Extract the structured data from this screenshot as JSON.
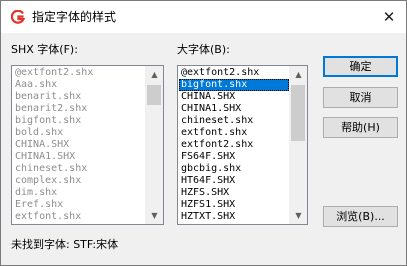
{
  "window": {
    "title": "指定字体的样式",
    "close_glyph": "✕",
    "accent_color": "#0078d7"
  },
  "shx_list": {
    "label": "SHX 字体(F):",
    "items": [
      "@extfont2.shx",
      "Aaa.shx",
      "benarit.shx",
      "benarit2.shx",
      "bigfont.shx",
      "bold.shx",
      "CHINA.SHX",
      "CHINA1.SHX",
      "chineset.shx",
      "complex.shx",
      "dim.shx",
      "Eref.shx",
      "extfont.shx"
    ]
  },
  "big_list": {
    "label": "大字体(B):",
    "selected_index": 1,
    "items": [
      "@extfont2.shx",
      "bigfont.shx",
      "CHINA.SHX",
      "CHINA1.SHX",
      "chineset.shx",
      "extfont.shx",
      "extfont2.shx",
      "FS64F.SHX",
      "gbcbig.shx",
      "HT64F.SHX",
      "HZFS.SHX",
      "HZFS1.SHX",
      "HZTXT.SHX"
    ]
  },
  "buttons": {
    "ok": "确定",
    "cancel": "取消",
    "help": "帮助(H)",
    "browse": "浏览(B)..."
  },
  "status": {
    "text": "未找到字体: STF:宋体"
  }
}
